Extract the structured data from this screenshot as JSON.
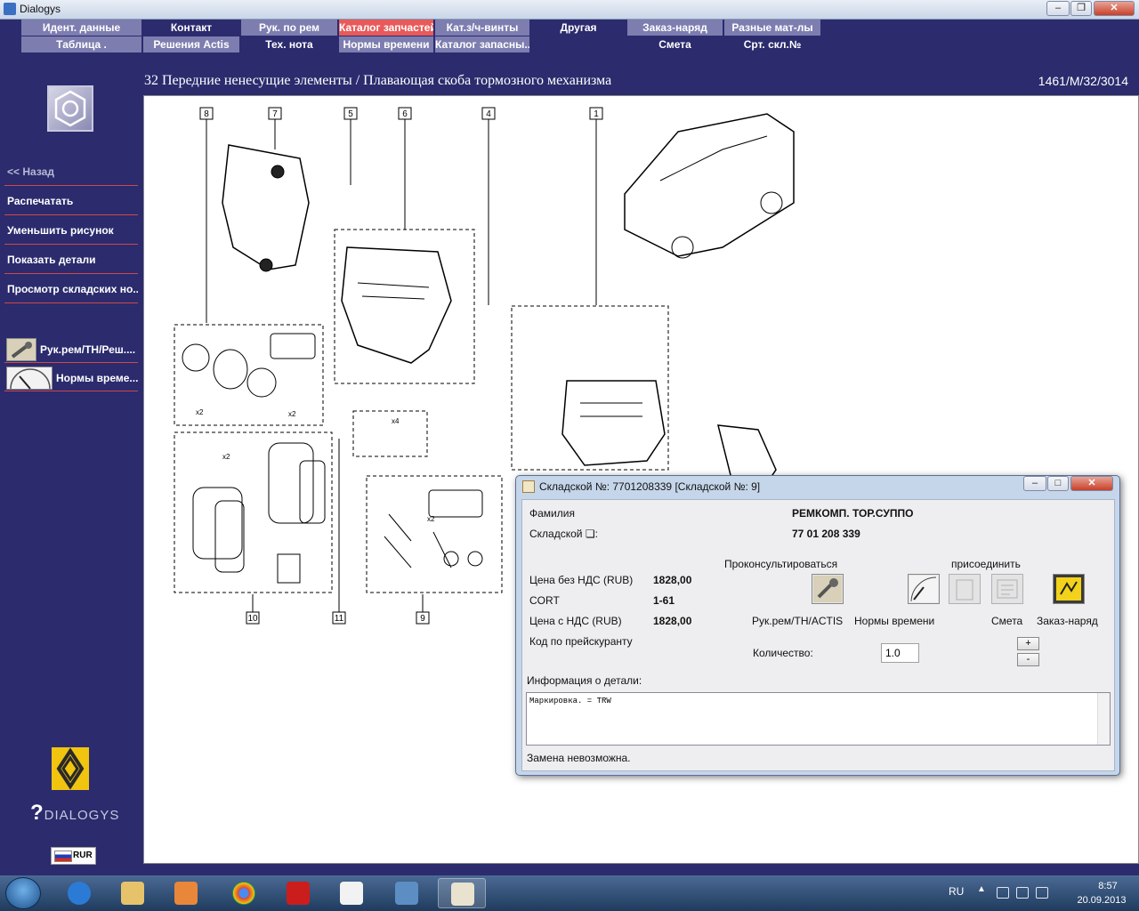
{
  "window": {
    "title": "Dialogys"
  },
  "menu": {
    "row1": [
      "Идент. данные",
      "Контакт",
      "Рук. по рем",
      "Каталог запчастей",
      "Кат.з/ч-винты",
      "Другая",
      "Заказ-наряд",
      "Разные мат-лы"
    ],
    "row2": [
      "Таблица .",
      "Решения Actis",
      "Тех. нота",
      "Нормы времени",
      "Каталог запасны...",
      "Смета",
      "Срт. скл.№"
    ]
  },
  "header": {
    "path": "32 Передние ненесущие элементы / Плавающая скоба тормозного механизма",
    "ref": "1461/M/32/3014"
  },
  "sidebar": {
    "back": "<< Назад",
    "print": "Распечатать",
    "shrink": "Уменьшить рисунок",
    "show_details": "Показать детали",
    "stock_view": "Просмотр складских но...",
    "tool1": "Рук.рем/ТН/Реш....",
    "tool2": "Нормы време...",
    "brand": "DIALOGYS",
    "currency": "RUR"
  },
  "drawing": {
    "callouts": [
      "8",
      "7",
      "5",
      "6",
      "4",
      "1",
      "10",
      "11",
      "9"
    ],
    "small_notes": [
      "x2",
      "x2",
      "x2",
      "x4",
      "x2"
    ]
  },
  "dialog": {
    "title": "Складской №: 7701208339 [Складской №: 9]",
    "family_label": "Фамилия",
    "family_value": "РЕМКОМП. ТОР.СУППО",
    "stock_label": "Складской ❏:",
    "stock_value": "77 01 208 339",
    "consult": "Проконсультироваться",
    "attach": "присоединить",
    "price_no_vat_label": "Цена без НДС (RUB)",
    "price_no_vat": "1828,00",
    "cort_label": "CORT",
    "cort_value": "1-61",
    "price_vat_label": "Цена с НДС (RUB)",
    "price_vat": "1828,00",
    "pricecode_label": "Код по прейскуранту",
    "btn_labels": [
      "Рук.рем/ТН/ACTIS",
      "Нормы времени",
      "Смета",
      "Заказ-наряд"
    ],
    "qty_label": "Количество:",
    "qty_value": "1.0",
    "plus": "+",
    "minus": "-",
    "info_label": "Информация о детали:",
    "info_text": "Маркировка. = TRW",
    "footer": "Замена невозможна."
  },
  "taskbar": {
    "lang": "RU",
    "time": "8:57",
    "date": "20.09.2013"
  },
  "colors": {
    "background": "#2b2b6e",
    "menu_highlight": "#e85a5a",
    "sidebar_divider": "#d04848"
  }
}
